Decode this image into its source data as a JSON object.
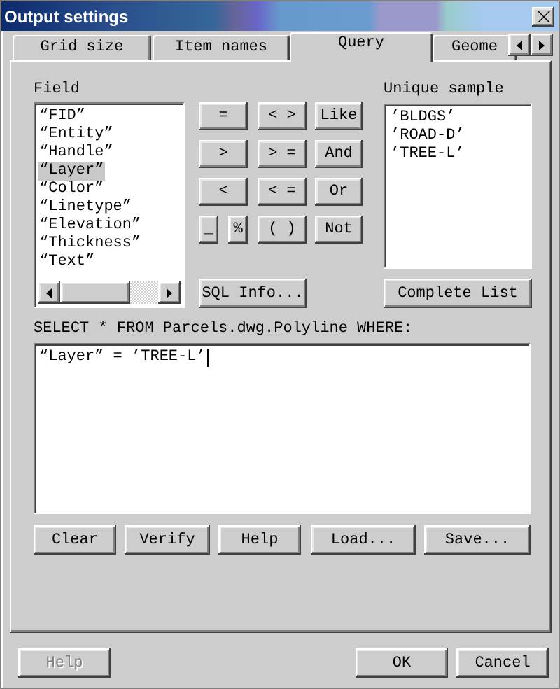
{
  "window": {
    "title": "Output settings"
  },
  "tabs": [
    {
      "label": "Grid size",
      "selected": false
    },
    {
      "label": "Item names",
      "selected": false
    },
    {
      "label": "Query",
      "selected": true
    },
    {
      "label": "Geome",
      "selected": false
    }
  ],
  "query": {
    "field_label": "Field",
    "fields": [
      {
        "label": "“FID”",
        "selected": false
      },
      {
        "label": "“Entity”",
        "selected": false
      },
      {
        "label": "“Handle”",
        "selected": false
      },
      {
        "label": "“Layer”",
        "selected": true
      },
      {
        "label": "“Color”",
        "selected": false
      },
      {
        "label": "“Linetype”",
        "selected": false
      },
      {
        "label": "“Elevation”",
        "selected": false
      },
      {
        "label": "“Thickness”",
        "selected": false
      },
      {
        "label": "“Text”",
        "selected": false
      }
    ],
    "operator_rows": [
      [
        {
          "label": "=",
          "kind": "full"
        },
        {
          "label": "< >",
          "kind": "full"
        },
        {
          "label": "Like",
          "kind": "full"
        }
      ],
      [
        {
          "label": ">",
          "kind": "full"
        },
        {
          "label": "> =",
          "kind": "full"
        },
        {
          "label": "And",
          "kind": "full"
        }
      ],
      [
        {
          "label": "<",
          "kind": "full"
        },
        {
          "label": "< =",
          "kind": "full"
        },
        {
          "label": "Or",
          "kind": "full"
        }
      ],
      [
        {
          "label": "_",
          "kind": "half"
        },
        {
          "label": "%",
          "kind": "half"
        },
        {
          "label": "( )",
          "kind": "full"
        },
        {
          "label": "Not",
          "kind": "full"
        }
      ]
    ],
    "sql_info_button": "SQL Info...",
    "unique_sample_label": "Unique sample",
    "unique_samples": [
      "’BLDGS’",
      "’ROAD-D’",
      "’TREE-L’"
    ],
    "complete_list_button": "Complete List",
    "select_label": "SELECT * FROM Parcels.dwg.Polyline WHERE:",
    "query_text": "“Layer” = ’TREE-L’",
    "buttons": [
      "Clear",
      "Verify",
      "Help",
      "Load...",
      "Save..."
    ]
  },
  "footer": {
    "help_button": {
      "label": "Help",
      "disabled": true
    },
    "ok_button": "OK",
    "cancel_button": "Cancel"
  }
}
